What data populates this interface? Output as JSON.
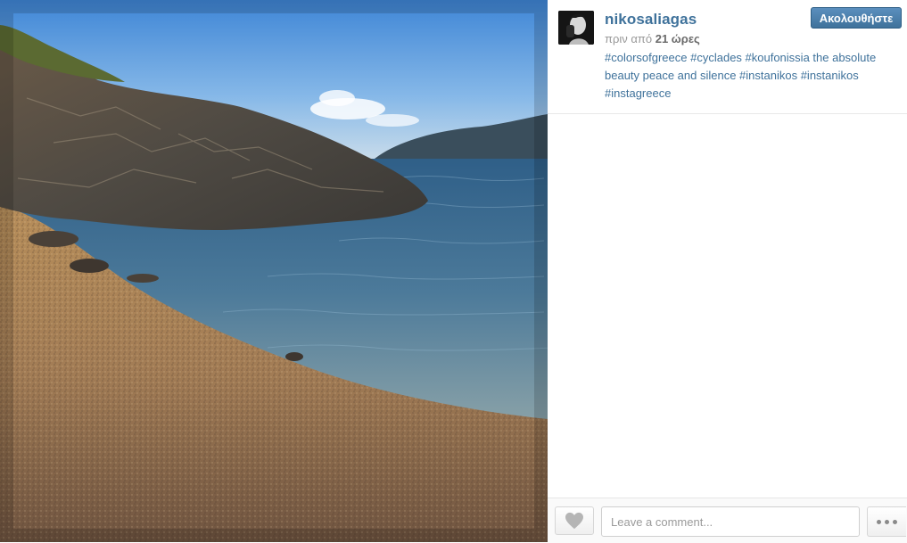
{
  "post": {
    "username": "nikosaliagas",
    "time_prefix": "πριν από",
    "time_value": "21 ώρες",
    "caption": "#colorsofgreece #cyclades #koufonissia the absolute beauty peace and silence #instanikos #instanikos #instagreece",
    "follow_label": "Ακολουθήστε"
  },
  "footer": {
    "comment_placeholder": "Leave a comment..."
  },
  "icons": {
    "like": "heart-icon",
    "more": "more-dots-icon"
  },
  "colors": {
    "link": "#3f729b",
    "follow_button": "#3f729b"
  }
}
